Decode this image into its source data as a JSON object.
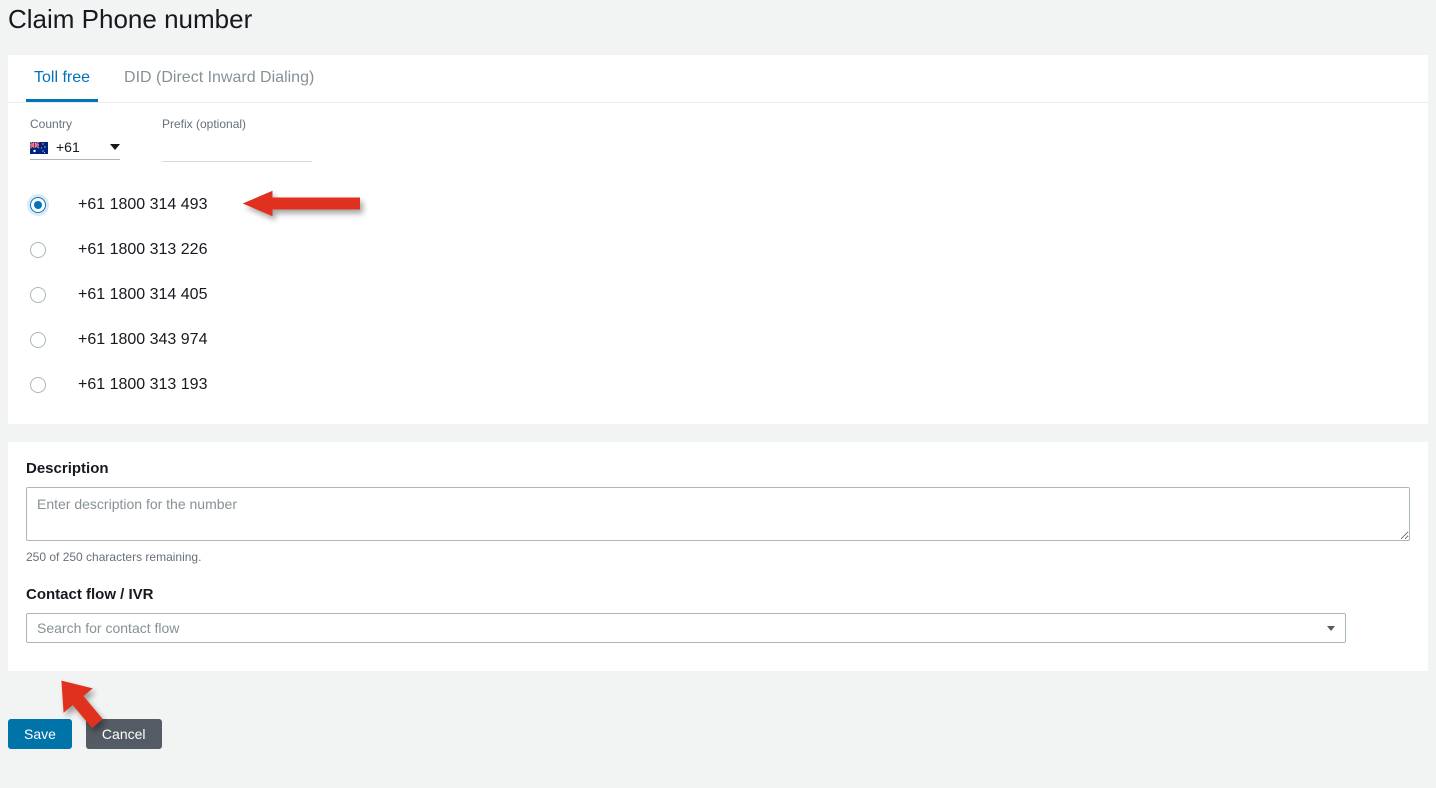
{
  "page": {
    "title": "Claim Phone number"
  },
  "tabs": {
    "items": [
      {
        "label": "Toll free",
        "active": true
      },
      {
        "label": "DID (Direct Inward Dialing)",
        "active": false
      }
    ]
  },
  "country": {
    "label": "Country",
    "code": "+61"
  },
  "prefix": {
    "label": "Prefix (optional)",
    "value": ""
  },
  "phoneOptions": {
    "selectedIndex": 0,
    "items": [
      {
        "number": "+61 1800 314 493"
      },
      {
        "number": "+61 1800 313 226"
      },
      {
        "number": "+61 1800 314 405"
      },
      {
        "number": "+61 1800 343 974"
      },
      {
        "number": "+61 1800 313 193"
      }
    ]
  },
  "description": {
    "label": "Description",
    "placeholder": "Enter description for the number",
    "remaining": "250 of 250 characters remaining."
  },
  "contactFlow": {
    "label": "Contact flow / IVR",
    "placeholder": "Search for contact flow"
  },
  "buttons": {
    "save": "Save",
    "cancel": "Cancel"
  }
}
